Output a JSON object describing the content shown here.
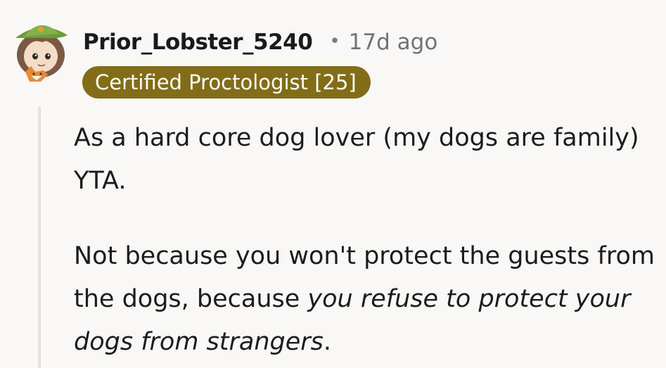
{
  "comment": {
    "author": "Prior_Lobster_5240",
    "separator": "•",
    "timestamp": "17d ago",
    "flair": "Certified Proctologist [25]",
    "paragraph1": "As a hard core dog lover (my dogs are family) YTA.",
    "paragraph2_plain": "Not because you won't protect the guests from the dogs, because ",
    "paragraph2_italic": "you refuse to protect your dogs from strangers",
    "paragraph2_end": "."
  },
  "avatar": {
    "icon": "user-avatar",
    "hat_color": "#6f9a3c",
    "hair_color": "#7a5a44",
    "fox_color": "#e8883a"
  },
  "colors": {
    "flair_bg": "#836c18",
    "flair_text": "#ffffff",
    "thread_line": "#e4e2e0",
    "background": "#faf8f7"
  }
}
